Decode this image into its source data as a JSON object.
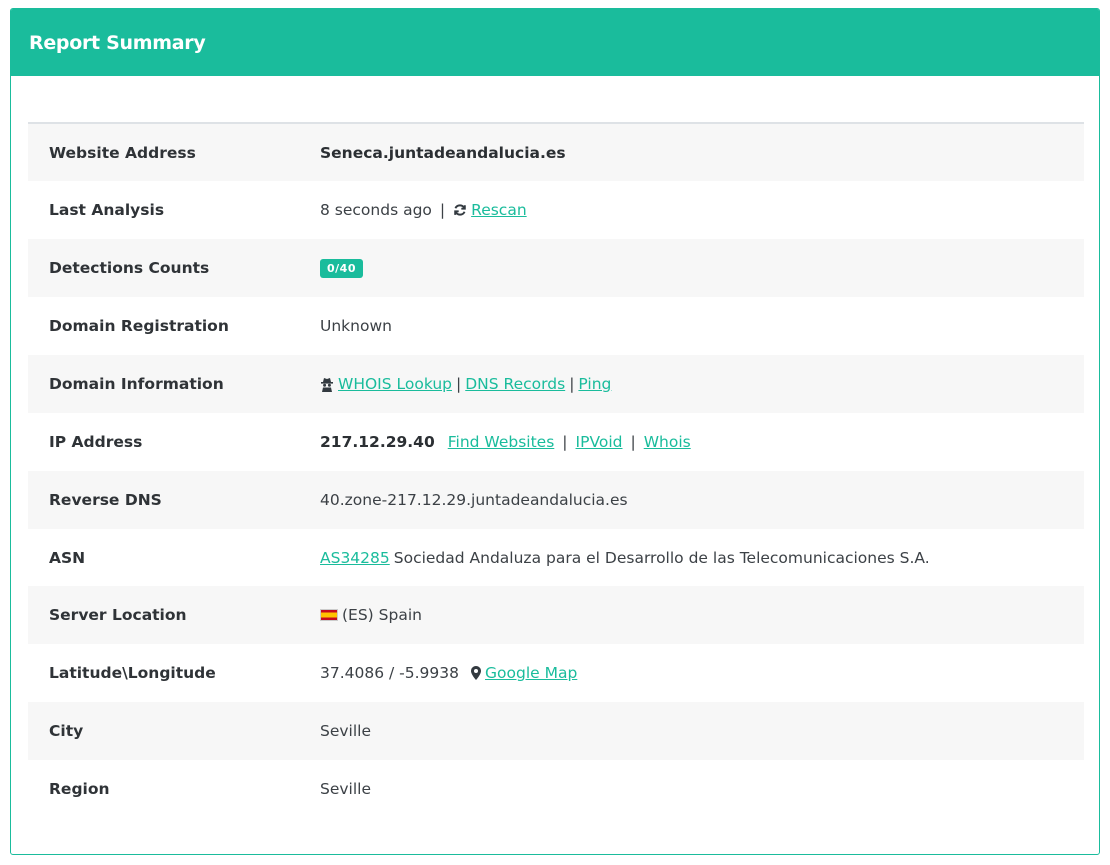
{
  "panel": {
    "title": "Report Summary"
  },
  "colors": {
    "accent": "#1abc9c",
    "row_alt": "#f7f7f7"
  },
  "rows": {
    "website": {
      "label": "Website Address",
      "value": "Seneca.juntadeandalucia.es"
    },
    "last_analysis": {
      "label": "Last Analysis",
      "value": "8 seconds ago",
      "sep": "|",
      "rescan": "Rescan",
      "icon": "refresh-icon"
    },
    "detections": {
      "label": "Detections Counts",
      "badge": "0/40"
    },
    "domain_registration": {
      "label": "Domain Registration",
      "value": "Unknown"
    },
    "domain_information": {
      "label": "Domain Information",
      "icon": "spy-icon",
      "whois": "WHOIS Lookup",
      "sep": "|",
      "dns": "DNS Records",
      "ping": "Ping"
    },
    "ip_address": {
      "label": "IP Address",
      "value": "217.12.29.40",
      "find": "Find Websites",
      "sep": "|",
      "ipvoid": "IPVoid",
      "whois": "Whois"
    },
    "reverse_dns": {
      "label": "Reverse DNS",
      "value": "40.zone-217.12.29.juntadeandalucia.es"
    },
    "asn": {
      "label": "ASN",
      "link": "AS34285",
      "value": "Sociedad Andaluza para el Desarrollo de las Telecomunicaciones S.A."
    },
    "server_location": {
      "label": "Server Location",
      "icon": "spain-flag-icon",
      "value": "(ES) Spain"
    },
    "lat_long": {
      "label": "Latitude\\Longitude",
      "value": "37.4086 / -5.9938",
      "icon": "map-marker-icon",
      "map": "Google Map"
    },
    "city": {
      "label": "City",
      "value": "Seville"
    },
    "region": {
      "label": "Region",
      "value": "Seville"
    }
  }
}
